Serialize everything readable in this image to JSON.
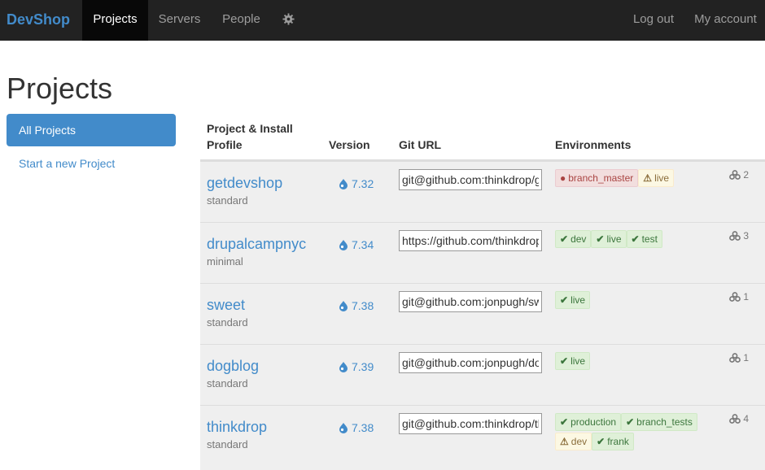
{
  "navbar": {
    "brand": "DevShop",
    "items": [
      "Projects",
      "Servers",
      "People"
    ],
    "right": [
      "Log out",
      "My account"
    ]
  },
  "page": {
    "title": "Projects"
  },
  "sidebar": {
    "active": "All Projects",
    "link": "Start a new Project"
  },
  "table": {
    "headers": {
      "project_line1": "Project & Install",
      "project_line2": "Profile",
      "version": "Version",
      "git": "Git URL",
      "envs": "Environments"
    },
    "rows": [
      {
        "name": "getdevshop",
        "profile": "standard",
        "version": "7.32",
        "git": "git@github.com:thinkdrop/getdevshop.git",
        "envs": [
          {
            "label": "branch_master",
            "status": "error"
          },
          {
            "label": "live",
            "status": "warning"
          }
        ],
        "count": "2"
      },
      {
        "name": "drupalcampnyc",
        "profile": "minimal",
        "version": "7.34",
        "git": "https://github.com/thinkdrop/drupalcampnyc.git",
        "envs": [
          {
            "label": "dev",
            "status": "ok"
          },
          {
            "label": "live",
            "status": "ok"
          },
          {
            "label": "test",
            "status": "ok"
          }
        ],
        "count": "3"
      },
      {
        "name": "sweet",
        "profile": "standard",
        "version": "7.38",
        "git": "git@github.com:jonpugh/sweet.git",
        "envs": [
          {
            "label": "live",
            "status": "ok"
          }
        ],
        "count": "1"
      },
      {
        "name": "dogblog",
        "profile": "standard",
        "version": "7.39",
        "git": "git@github.com:jonpugh/dogblog.git",
        "envs": [
          {
            "label": "live",
            "status": "ok"
          }
        ],
        "count": "1"
      },
      {
        "name": "thinkdrop",
        "profile": "standard",
        "version": "7.38",
        "git": "git@github.com:thinkdrop/thinkdrop.git",
        "envs": [
          {
            "label": "production",
            "status": "ok"
          },
          {
            "label": "branch_tests",
            "status": "ok"
          },
          {
            "label": "dev",
            "status": "warning"
          },
          {
            "label": "frank",
            "status": "ok"
          }
        ],
        "count": "4"
      }
    ]
  },
  "colors": {
    "link": "#428bca",
    "navbar": "#222222",
    "ok": "#3c763d",
    "error": "#a94442",
    "warning": "#8a6d3b"
  }
}
